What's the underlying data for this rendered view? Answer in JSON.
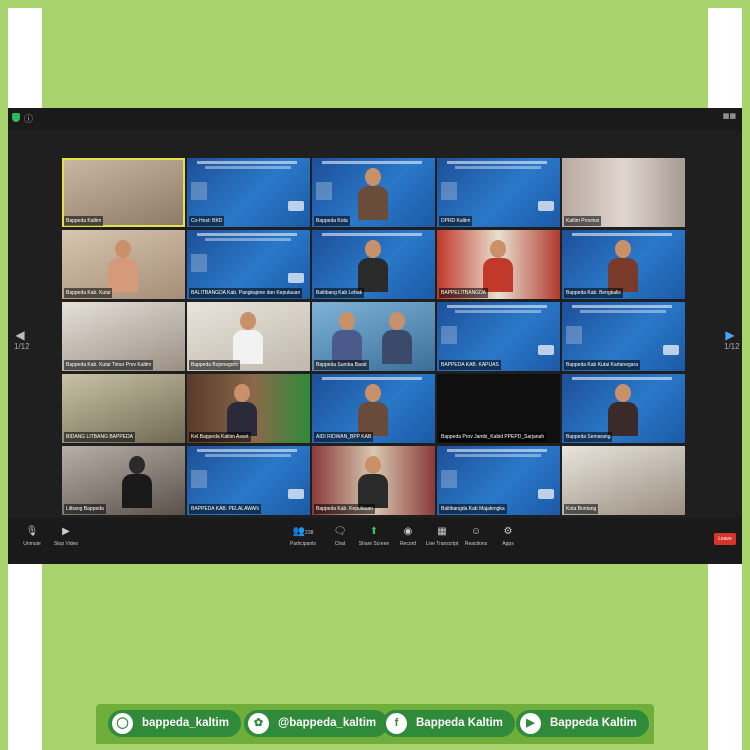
{
  "toolbar": {
    "unmute": "Unmute",
    "stop_video": "Stop Video",
    "participants": "Participants",
    "participants_count": "238",
    "chat": "Chat",
    "share_screen": "Share Screen",
    "record": "Record",
    "live_transcript": "Live Transcript",
    "reactions": "Reactions",
    "apps": "Apps",
    "leave": "Leave"
  },
  "pagination": {
    "left": "1/12",
    "right": "1/12"
  },
  "tiles": [
    "Bappeda Kaltim",
    "Co-Host: BKD",
    "Bappeda Kota",
    "DPRD Kaltim",
    "Kaltim Provinsi",
    "Bappeda Kab. Kutai",
    "BALITBANGDA Kab. Pangkajene dan Kepulauan",
    "Balitbang Kab Lebak",
    "BAPPELITBANGDA",
    "Bappeda Kab. Bengkalis",
    "Bappeda Kab. Kutai Timur Prov Kaltim",
    "Bappeda Bojonegoro",
    "Bappeda Sumba Barat",
    "BAPPEDA KAB. KAPUAS",
    "Bappeda Kab Kutai Kartanegara",
    "BIDANG LITBANG BAPPEDA",
    "Kel.Bappeda Kaltim Asset",
    "AIDI RIDWAN_BPP KAB",
    "Bappeda Prov Jambi_Kabid PPEPD_Sarjanah",
    "Bappeda Semarang",
    "Litbang Bappeda",
    "BAPPEDA KAB. PELALAWAN",
    "Bappeda Kab. Kepulauan",
    "Balitbangda Kab Majalengka",
    "Kota Bontang"
  ],
  "social": {
    "instagram": "bappeda_kaltim",
    "twitter": "@bappeda_kaltim",
    "facebook": "Bappeda Kaltim",
    "youtube": "Bappeda Kaltim"
  },
  "colors": {
    "green_bg": "#a9d36c",
    "pill": "#2f8a3a",
    "leave": "#d9332e",
    "share": "#36c45c"
  }
}
